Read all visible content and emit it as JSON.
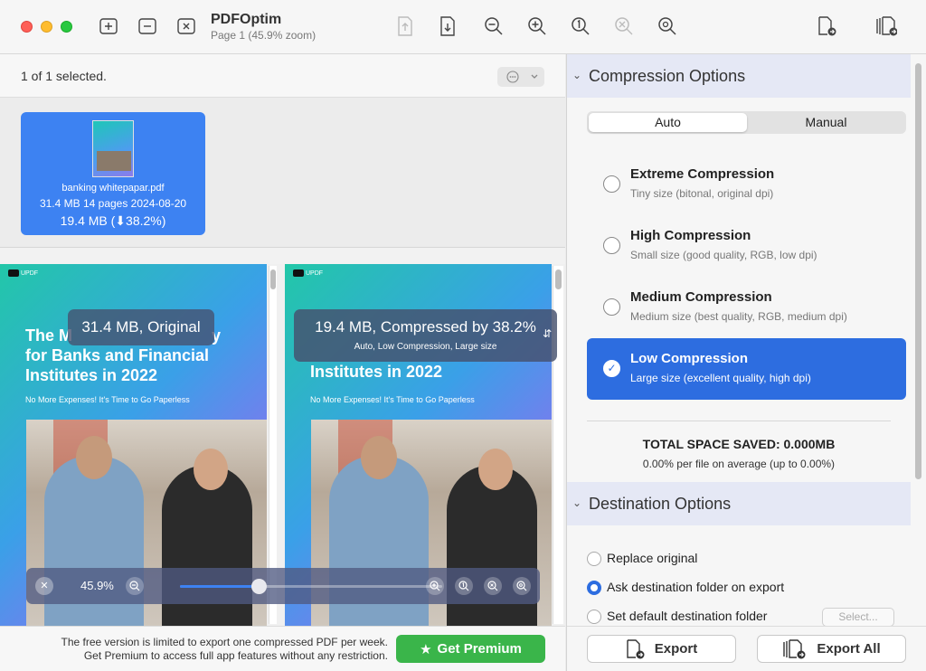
{
  "titlebar": {
    "app_name": "PDFOptim",
    "subtitle": "Page 1 (45.9% zoom)"
  },
  "selection": {
    "text": "1 of 1 selected."
  },
  "file": {
    "name": "banking whitepapar.pdf",
    "meta": "31.4 MB 14 pages 2024-08-20",
    "result": "19.4 MB  (⬇38.2%)"
  },
  "preview": {
    "brand": "UPDF",
    "title_left": "The M… for Banks and Financial Institutes in 2022",
    "title_line2": "for Banks and Financial",
    "title_line3": "Institutes in 2022",
    "title_line1_partial": "The M",
    "title_line1_tail": "y",
    "subtitle": "No More Expenses! It's Time to Go Paperless",
    "original_label": "31.4 MB, Original",
    "compressed_label": "19.4 MB, Compressed by 38.2%",
    "compressed_detail": "Auto, Low Compression, Large size",
    "zoom_label": "45.9%",
    "zoom_fraction": 0.3
  },
  "notice": {
    "line1": "The free version is limited to export one compressed PDF per week.",
    "line2": "Get Premium to access full app features without any restriction."
  },
  "premium_label": "Get Premium",
  "compression": {
    "section_title": "Compression Options",
    "tabs": [
      "Auto",
      "Manual"
    ],
    "options": [
      {
        "name": "Extreme Compression",
        "desc": "Tiny size (bitonal, original dpi)",
        "selected": false
      },
      {
        "name": "High Compression",
        "desc": "Small size (good quality, RGB, low dpi)",
        "selected": false
      },
      {
        "name": "Medium Compression",
        "desc": "Medium size (best quality, RGB, medium dpi)",
        "selected": false
      },
      {
        "name": "Low Compression",
        "desc": "Large size (excellent quality, high dpi)",
        "selected": true
      }
    ],
    "saved_title": "TOTAL SPACE SAVED: 0.000MB",
    "saved_sub": "0.00% per file on average (up to 0.00%)"
  },
  "destination": {
    "section_title": "Destination Options",
    "options": [
      {
        "label": "Replace original",
        "selected": false
      },
      {
        "label": "Ask destination folder on export",
        "selected": true
      },
      {
        "label": "Set default destination folder",
        "selected": false
      }
    ],
    "select_label": "Select..."
  },
  "export": {
    "export_label": "Export",
    "export_all_label": "Export All"
  },
  "colors": {
    "accent": "#2d6de0",
    "file_card": "#3d82f2",
    "premium": "#3ab54a"
  }
}
